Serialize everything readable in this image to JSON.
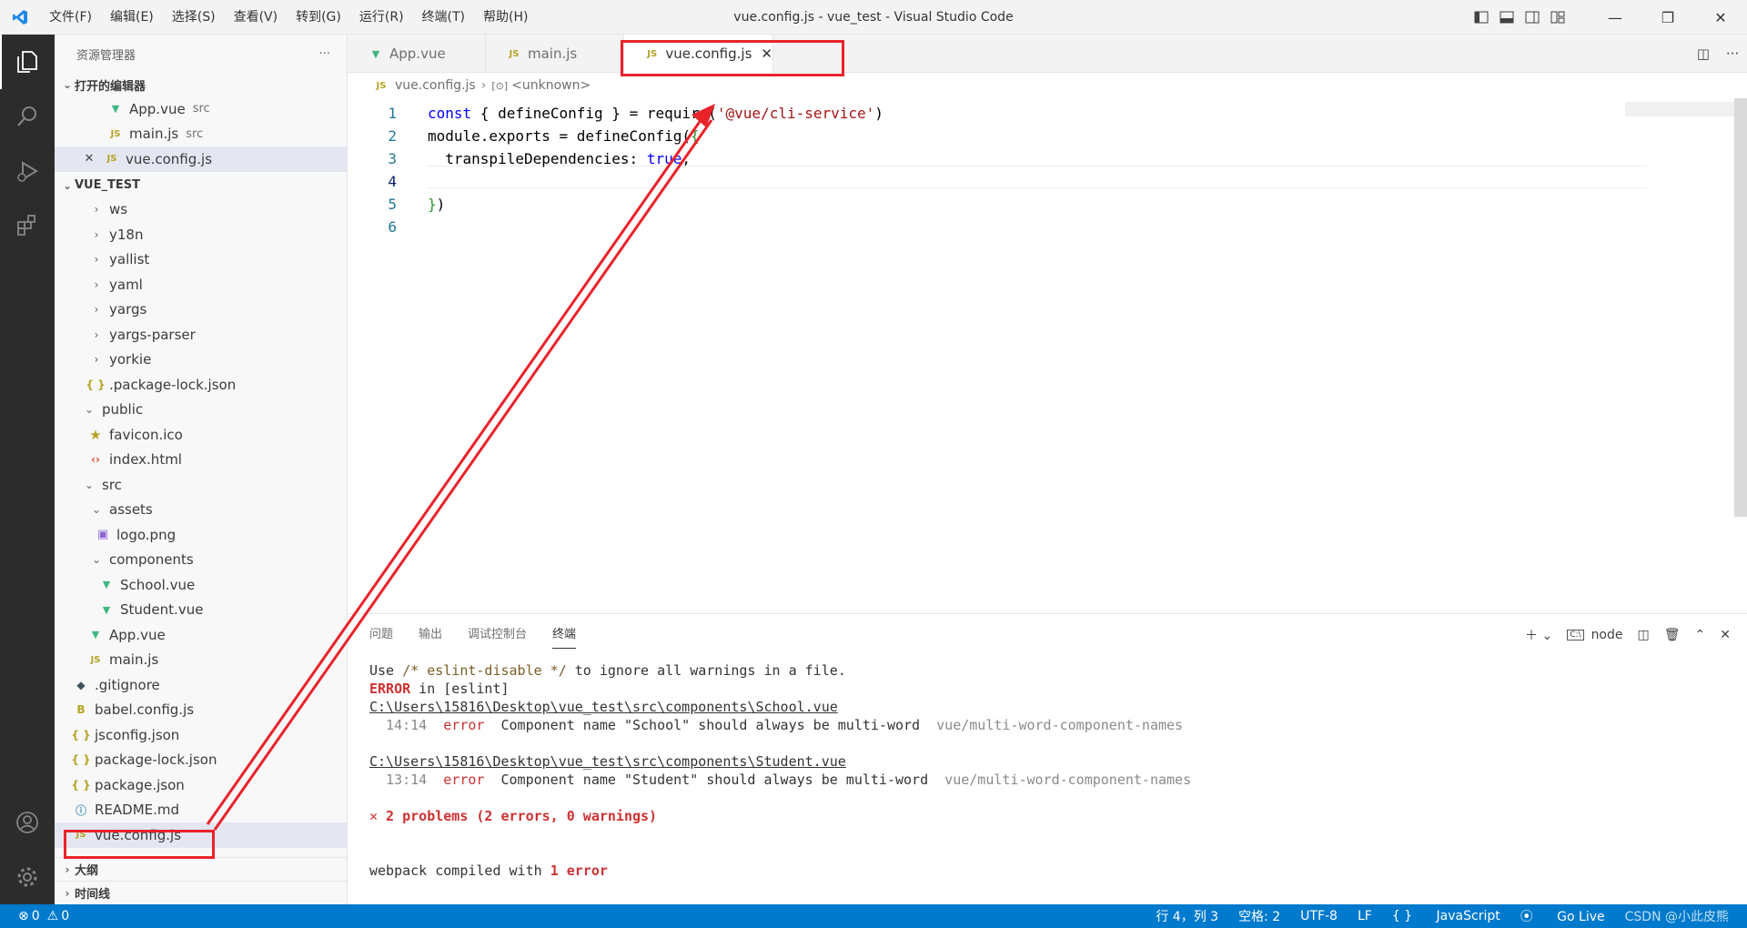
{
  "window_title": "vue.config.js - vue_test - Visual Studio Code",
  "menu": [
    "文件(F)",
    "编辑(E)",
    "选择(S)",
    "查看(V)",
    "转到(G)",
    "运行(R)",
    "终端(T)",
    "帮助(H)"
  ],
  "sidebar": {
    "title": "资源管理器",
    "more": "···",
    "open_editors_label": "打开的编辑器",
    "open_editors": [
      {
        "name": "App.vue",
        "desc": "src",
        "icon": "vue-icon"
      },
      {
        "name": "main.js",
        "desc": "src",
        "icon": "js-icon"
      },
      {
        "name": "vue.config.js",
        "desc": "",
        "icon": "js-icon"
      }
    ],
    "project_label": "VUE_TEST",
    "tree": [
      {
        "name": "ws",
        "type": "folder-collapsed"
      },
      {
        "name": "y18n",
        "type": "folder-collapsed"
      },
      {
        "name": "yallist",
        "type": "folder-collapsed"
      },
      {
        "name": "yaml",
        "type": "folder-collapsed"
      },
      {
        "name": "yargs",
        "type": "folder-collapsed"
      },
      {
        "name": "yargs-parser",
        "type": "folder-collapsed"
      },
      {
        "name": "yorkie",
        "type": "folder-collapsed"
      },
      {
        "name": ".package-lock.json",
        "type": "json"
      },
      {
        "name": "public",
        "type": "folder-open"
      },
      {
        "name": "favicon.ico",
        "type": "ico"
      },
      {
        "name": "index.html",
        "type": "html"
      },
      {
        "name": "src",
        "type": "folder-open"
      },
      {
        "name": "assets",
        "type": "folder-open"
      },
      {
        "name": "logo.png",
        "type": "png"
      },
      {
        "name": "components",
        "type": "folder-open"
      },
      {
        "name": "School.vue",
        "type": "vue"
      },
      {
        "name": "Student.vue",
        "type": "vue"
      },
      {
        "name": "App.vue",
        "type": "vue"
      },
      {
        "name": "main.js",
        "type": "js"
      },
      {
        "name": ".gitignore",
        "type": "git"
      },
      {
        "name": "babel.config.js",
        "type": "babel"
      },
      {
        "name": "jsconfig.json",
        "type": "json"
      },
      {
        "name": "package-lock.json",
        "type": "json"
      },
      {
        "name": "package.json",
        "type": "json"
      },
      {
        "name": "README.md",
        "type": "info"
      },
      {
        "name": "vue.config.js",
        "type": "js"
      }
    ],
    "outline_label": "大纲",
    "timeline_label": "时间线"
  },
  "tabs": [
    {
      "label": "App.vue",
      "icon": "vue-icon"
    },
    {
      "label": "main.js",
      "icon": "js-icon"
    },
    {
      "label": "vue.config.js",
      "icon": "js-icon",
      "close": "✕"
    }
  ],
  "breadcrumb": {
    "file": "vue.config.js",
    "symbol": "<unknown>"
  },
  "code": {
    "line_numbers": [
      "1",
      "2",
      "3",
      "4",
      "5",
      "6"
    ],
    "l1_a": "const",
    "l1_b": " { defineConfig } = require(",
    "l1_c": "'@vue/cli-service'",
    "l1_d": ")",
    "l2_a": "module.exports = defineConfig(",
    "l2_b": "{",
    "l3_a": "  transpileDependencies: ",
    "l3_b": "true",
    "l3_c": ",",
    "l5_a": "}",
    "l5_b": ")"
  },
  "panel": {
    "tabs": [
      "问题",
      "输出",
      "调试控制台",
      "终端"
    ],
    "shell": "node",
    "terminal": {
      "l1_a": "Use ",
      "l1_b": "/* eslint-disable */",
      "l1_c": " to ignore all warnings in a file.",
      "l2_a": "ERROR",
      "l2_b": " in [eslint]",
      "l3": "C:\\Users\\15816\\Desktop\\vue_test\\src\\components\\School.vue",
      "l4_pos": "  14:14",
      "l4_err": "error",
      "l4_msg": "  Component name \"School\" should always be multi-word",
      "l4_rule": "  vue/multi-word-component-names",
      "l6": "C:\\Users\\15816\\Desktop\\vue_test\\src\\components\\Student.vue",
      "l7_pos": "  13:14",
      "l7_err": "error",
      "l7_msg": "  Component name \"Student\" should always be multi-word",
      "l7_rule": "  vue/multi-word-component-names",
      "l9_x": "✕",
      "l9": " 2 problems (2 errors, 0 warnings)",
      "l12_a": "webpack compiled with ",
      "l12_b": "1 error"
    }
  },
  "status": {
    "errors": "0",
    "warnings": "0",
    "position": "行 4，列 3",
    "spaces": "空格: 2",
    "encoding": "UTF-8",
    "eol": "LF",
    "language": "JavaScript",
    "golive": "Go Live",
    "watermark": "CSDN @小此皮熊"
  },
  "colors": {
    "accent": "#007acc",
    "annotation": "#e8232a"
  }
}
